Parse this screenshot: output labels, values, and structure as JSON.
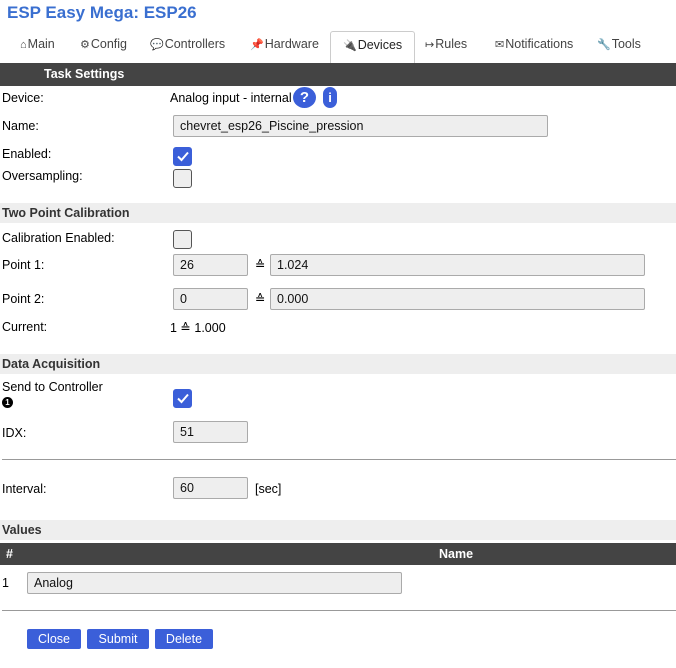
{
  "app": {
    "title": "ESP Easy Mega: ESP26"
  },
  "tabs": [
    {
      "label": "Main",
      "icon": "⌂"
    },
    {
      "label": "Config",
      "icon": "⚙"
    },
    {
      "label": "Controllers",
      "icon": "💬"
    },
    {
      "label": "Hardware",
      "icon": "📌"
    },
    {
      "label": "Devices",
      "icon": "🔌"
    },
    {
      "label": "Rules",
      "icon": "↦"
    },
    {
      "label": "Notifications",
      "icon": "✉"
    },
    {
      "label": "Tools",
      "icon": "🔧"
    }
  ],
  "task_settings": {
    "header": "Task Settings",
    "device_label": "Device:",
    "device_value": "Analog input - internal",
    "help_glyph": "?",
    "info_glyph": "i",
    "name_label": "Name:",
    "name_value": "chevret_esp26_Piscine_pression",
    "enabled_label": "Enabled:",
    "enabled": true,
    "oversampling_label": "Oversampling:",
    "oversampling": false
  },
  "calibration": {
    "header": "Two Point Calibration",
    "enabled_label": "Calibration Enabled:",
    "enabled": false,
    "point1_label": "Point 1:",
    "point1_adc": "26",
    "point1_value": "1.024",
    "point2_label": "Point 2:",
    "point2_adc": "0",
    "point2_value": "0.000",
    "maps_symbol": "≙",
    "current_label": "Current:",
    "current_value": "1 ≙ 1.000"
  },
  "data_acquisition": {
    "header": "Data Acquisition",
    "send_label": "Send to Controller",
    "controller_number": "1",
    "send": true,
    "idx_label": "IDX:",
    "idx_value": "51",
    "interval_label": "Interval:",
    "interval_value": "60",
    "interval_unit": "[sec]"
  },
  "values": {
    "header": "Values",
    "col_number": "#",
    "col_name": "Name",
    "rows": [
      {
        "number": "1",
        "name": "Analog"
      }
    ]
  },
  "buttons": {
    "close": "Close",
    "submit": "Submit",
    "delete": "Delete"
  },
  "colors": {
    "accent": "#3b5fd9",
    "title": "#3a6fd0",
    "header_bar": "#444444",
    "section_bg": "#eeeeee"
  }
}
